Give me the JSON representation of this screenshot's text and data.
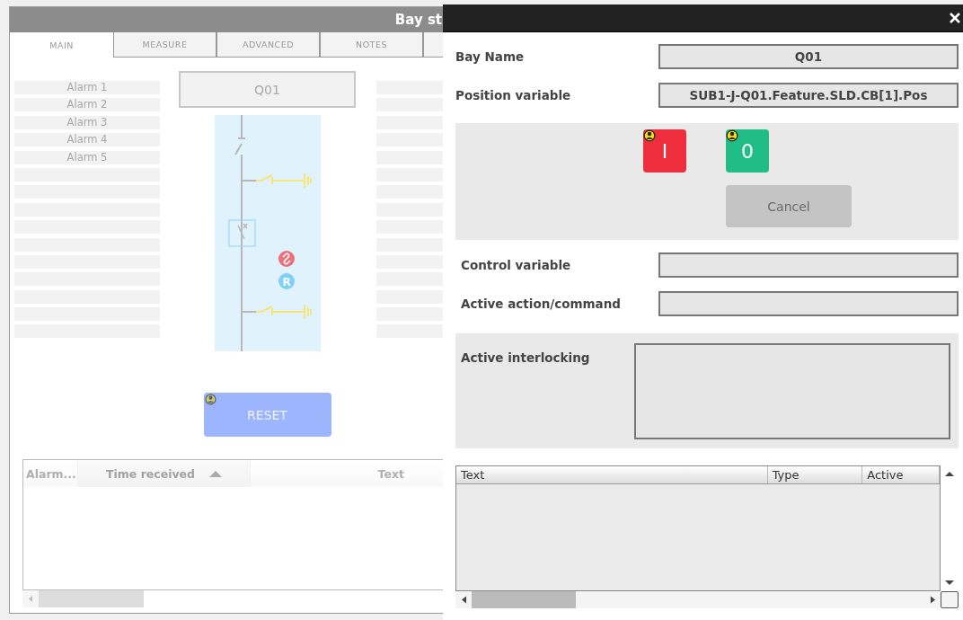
{
  "bay_window": {
    "title": "Bay st",
    "tabs": [
      {
        "label": "MAIN",
        "selected": true
      },
      {
        "label": "MEASURE",
        "selected": false
      },
      {
        "label": "ADVANCED",
        "selected": false
      },
      {
        "label": "NOTES",
        "selected": false
      }
    ],
    "alarms": [
      "Alarm 1",
      "Alarm 2",
      "Alarm 3",
      "Alarm 4",
      "Alarm 5"
    ],
    "bay_name": "Q01",
    "diagram": {
      "r_badge": "R"
    },
    "reset_button": {
      "label": "RESET",
      "disabled": true
    },
    "alarm_table": {
      "columns": [
        {
          "label": "Alarm...",
          "sorted": false
        },
        {
          "label": "Time received",
          "sorted": true
        },
        {
          "label": "Text",
          "sorted": false
        }
      ]
    }
  },
  "control_dialog": {
    "fields": [
      {
        "label": "Bay Name",
        "value": "Q01"
      },
      {
        "label": "Position variable",
        "value": "SUB1-J-Q01.Feature.SLD.CB[1].Pos"
      }
    ],
    "commands": [
      {
        "label": "I",
        "color": "#ee2d3d"
      },
      {
        "label": "0",
        "color": "#21bd86"
      }
    ],
    "cancel_button": {
      "label": "Cancel",
      "disabled": true
    },
    "status_fields": [
      {
        "label": "Control variable"
      },
      {
        "label": "Active action/command"
      }
    ],
    "interlocking": {
      "label": "Active interlocking"
    },
    "events_table": {
      "columns": [
        "Text",
        "Type",
        "Active"
      ]
    }
  }
}
